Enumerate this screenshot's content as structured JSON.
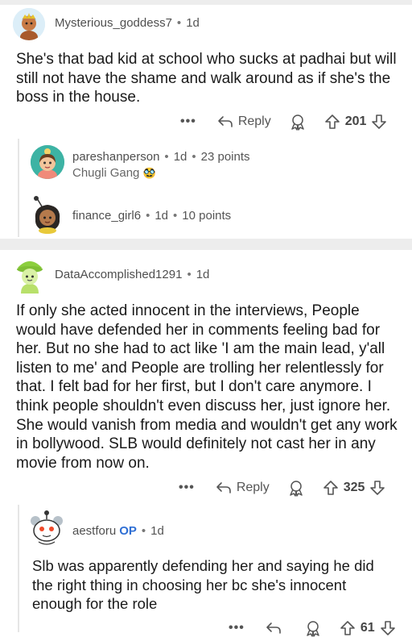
{
  "comments": [
    {
      "username": "Mysterious_goddess7",
      "age": "1d",
      "body": "She's that bad kid at school who sucks at padhai but will still not have the shame and walk around as if she's the boss in the house.",
      "reply_label": "Reply",
      "score": "201"
    },
    {
      "username": "DataAccomplished1291",
      "age": "1d",
      "body": "If only she acted innocent in the interviews, People would have defended her in comments feeling bad for her.  But no she had to act like 'I am the main lead, y'all listen to me' and People are trolling her relentlessly for that. I felt bad for her first, but I don't care anymore. I think people shouldn't even discuss her, just ignore her. She would vanish from media and wouldn't get any work in bollywood. SLB would definitely not cast her in any movie from now on.",
      "reply_label": "Reply",
      "score": "325"
    }
  ],
  "collapsed_replies": [
    {
      "username": "pareshanperson",
      "age": "1d",
      "points": "23 points",
      "flair": "Chugli Gang"
    },
    {
      "username": "finance_girl6",
      "age": "1d",
      "points": "10 points"
    }
  ],
  "op_reply": {
    "username": "aestforu",
    "op_badge": "OP",
    "age": "1d",
    "body": "Slb was apparently defending her and saying he did the right thing in choosing her bc she's innocent enough for the role",
    "score": "61"
  },
  "icons": {
    "more": "more-dots-icon",
    "reply": "reply-arrow-icon",
    "award": "award-icon",
    "upvote": "upvote-arrow-icon",
    "downvote": "downvote-arrow-icon"
  },
  "colors": {
    "op": "#2f6fd4",
    "separator": "#ededed"
  }
}
